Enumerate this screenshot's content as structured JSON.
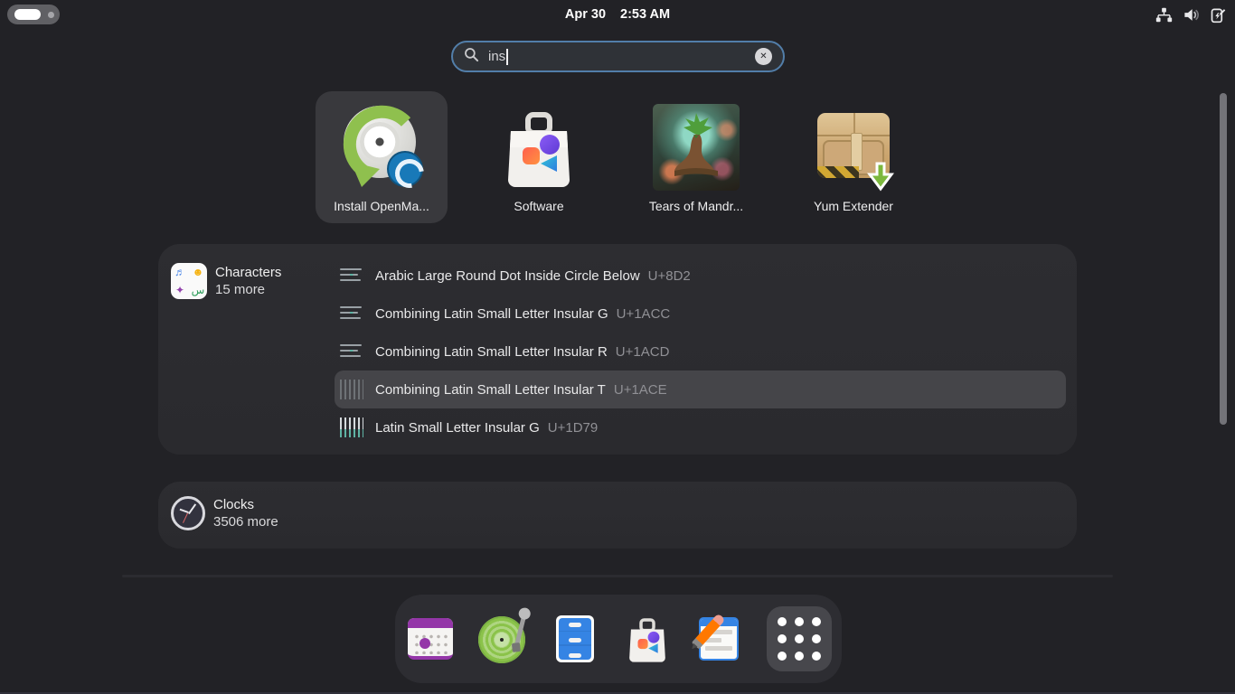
{
  "colors": {
    "background": "#222226",
    "panel_bg": "#2c2c30",
    "accent_blue": "#527ea9",
    "highlight_row": "#454549",
    "dock_bg": "#2d2d32",
    "active_button_bg": "#47474c"
  },
  "topbar": {
    "date": "Apr 30",
    "time": "2:53 AM",
    "right_icons": [
      "network-wired-icon",
      "volume-icon",
      "battery-charging-icon"
    ]
  },
  "search": {
    "value": "ins",
    "icons": [
      "search-icon",
      "clear-icon"
    ]
  },
  "apps": [
    {
      "label": "Install OpenMa...",
      "selected": true,
      "icon": "install-openmandriva-icon"
    },
    {
      "label": "Software",
      "selected": false,
      "icon": "software-bag-icon"
    },
    {
      "label": "Tears of Mandr...",
      "selected": false,
      "icon": "tears-of-mandrake-image"
    },
    {
      "label": "Yum Extender",
      "selected": false,
      "icon": "yum-extender-box-icon"
    }
  ],
  "characters": {
    "app_name": "Characters",
    "more": "15 more",
    "app_icon_glyphs": {
      "tl": "♬",
      "tr": "☻",
      "bl": "✦",
      "br": "س"
    },
    "results": [
      {
        "title": "Arabic Large Round Dot Inside Circle Below",
        "code": "U+8D2",
        "highlighted": false
      },
      {
        "title": "Combining Latin Small Letter Insular G",
        "code": "U+1ACC",
        "highlighted": false
      },
      {
        "title": "Combining Latin Small Letter Insular R",
        "code": "U+1ACD",
        "highlighted": false
      },
      {
        "title": "Combining Latin Small Letter Insular T",
        "code": "U+1ACE",
        "highlighted": true
      },
      {
        "title": "Latin Small Letter Insular G",
        "code": "U+1D79",
        "highlighted": false
      }
    ]
  },
  "clocks": {
    "app_name": "Clocks",
    "more": "3506 more"
  },
  "dock": {
    "items": [
      "calendar",
      "music",
      "files",
      "software",
      "text-editor",
      "app-grid"
    ],
    "active_item": "app-grid"
  },
  "workspace_indicator": {
    "workspaces": 2,
    "active_index": 0
  }
}
